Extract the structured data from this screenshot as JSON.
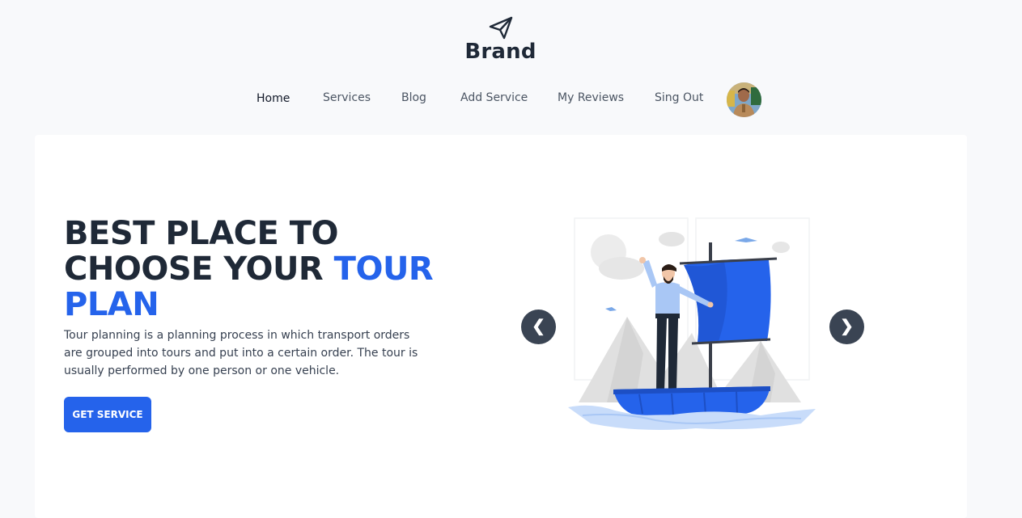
{
  "brand": {
    "name": "Brand",
    "icon": "paper-plane-icon"
  },
  "nav": {
    "items": [
      {
        "label": "Home",
        "active": true
      },
      {
        "label": "Services"
      },
      {
        "label": "Blog"
      },
      {
        "label": "Add Service"
      },
      {
        "label": "My Reviews"
      },
      {
        "label": "Sing Out"
      }
    ]
  },
  "hero": {
    "title_line1": "BEST PLACE TO",
    "title_line2_part1": "CHOOSE YOUR ",
    "title_line2_accent": "TOUR",
    "title_line3_accent": "PLAN",
    "description": "Tour planning is a planning process in which transport orders are grouped into tours and put into a certain order. The tour is usually performed by one person or one vehicle.",
    "cta_label": "GET SERVICE",
    "prev_label": "❮",
    "next_label": "❯"
  },
  "colors": {
    "accent": "#2563eb",
    "text_dark": "#1f2937",
    "carousel_button": "#3a4453"
  }
}
